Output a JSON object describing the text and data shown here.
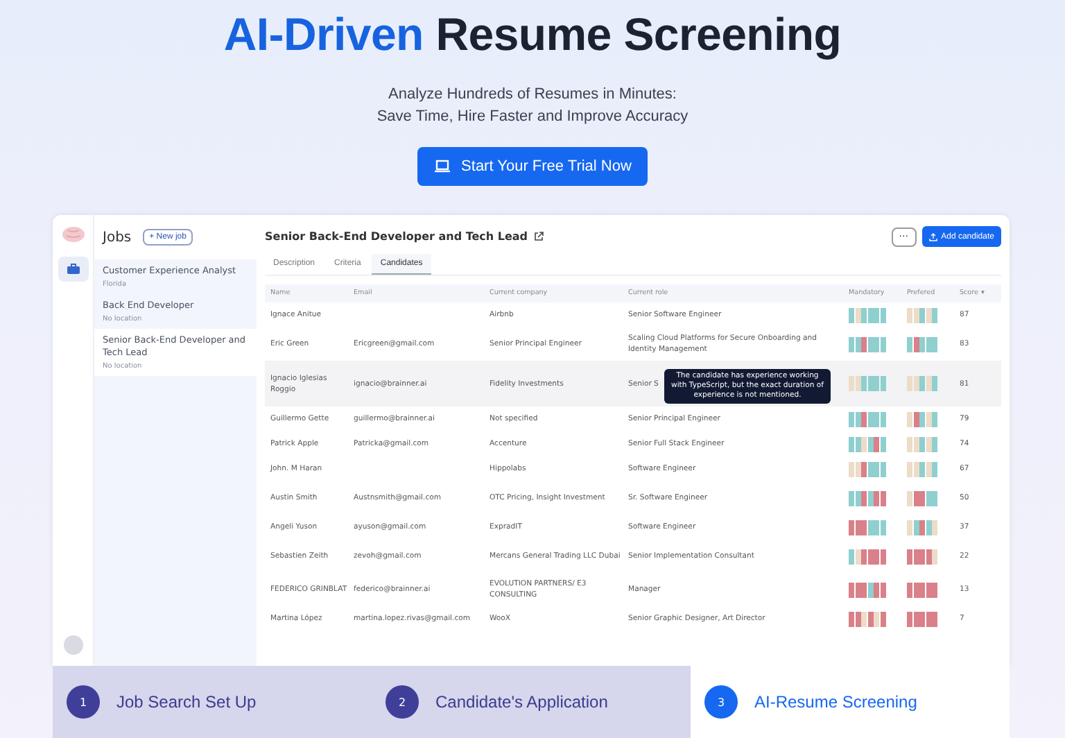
{
  "hero": {
    "title_highlight": "AI-Driven",
    "title_rest": "Resume Screening",
    "subtitle_lines": [
      "Analyze Hundreds of Resumes in Minutes:",
      "Save Time, Hire Faster and Improve Accuracy"
    ],
    "cta": "Start Your Free Trial Now"
  },
  "jobs_panel": {
    "title": "Jobs",
    "new_button": "+ New job",
    "items": [
      {
        "title": "Customer Experience Analyst",
        "location": "Florida",
        "selected": false
      },
      {
        "title": "Back End Developer",
        "location": "No location",
        "selected": false
      },
      {
        "title": "Senior Back-End Developer and Tech Lead",
        "location": "No location",
        "selected": true
      }
    ]
  },
  "job": {
    "title": "Senior Back-End Developer and Tech Lead",
    "more_button": "···",
    "add_button": "Add candidate",
    "tabs": [
      {
        "label": "Description",
        "selected": false
      },
      {
        "label": "Criteria",
        "selected": false
      },
      {
        "label": "Candidates",
        "selected": true
      }
    ]
  },
  "table": {
    "columns": [
      "Name",
      "Email",
      "Current company",
      "Current role",
      "Mandatory",
      "Prefered",
      "Score"
    ],
    "sort_mark": "▾",
    "rows": [
      {
        "name": "Ignace Anitue",
        "email": "",
        "company": "Airbnb",
        "role": "Senior Software Engineer",
        "mandatory": [
          {
            "color": "#8fcfcf"
          },
          {
            "color": "#ecdcc8"
          },
          {
            "color": "#8fcfcf"
          },
          {
            "color": "#8fcfcf"
          },
          {
            "color": "#8fcfcf"
          },
          {
            "color": "#8fcfcf"
          }
        ],
        "preferred": [
          {
            "color": "#ecdcc8"
          },
          {
            "color": "#ecdcc8"
          },
          {
            "color": "#8fcfcf"
          },
          {
            "color": "#ecdcc8"
          },
          {
            "color": "#8fcfcf"
          }
        ],
        "score": "87",
        "highlighted": false
      },
      {
        "name": "Eric Green",
        "email": "Ericgreen@gmail.com",
        "company": "Senior Principal Engineer",
        "role": "Scaling Cloud Platforms for Secure Onboarding and Identity Management",
        "mandatory": [
          {
            "color": "#8fcfcf"
          },
          {
            "color": "#8fcfcf"
          },
          {
            "color": "#d98089"
          },
          {
            "color": "#8fcfcf"
          },
          {
            "color": "#8fcfcf"
          },
          {
            "color": "#8fcfcf"
          }
        ],
        "preferred": [
          {
            "color": "#8fcfcf"
          },
          {
            "color": "#d98089"
          },
          {
            "color": "#8fcfcf"
          },
          {
            "color": "#8fcfcf"
          },
          {
            "color": "#8fcfcf"
          }
        ],
        "score": "83",
        "highlighted": false
      },
      {
        "name": "Ignacio Iglesias Roggio",
        "email": "ignacio@brainner.ai",
        "company": "Fidelity Investments",
        "role": "Senior S",
        "mandatory": [
          {
            "color": "#ecdcc8"
          },
          {
            "color": "#ecdcc8"
          },
          {
            "color": "#8fcfcf"
          },
          {
            "color": "#8fcfcf"
          },
          {
            "color": "#8fcfcf"
          },
          {
            "color": "#8fcfcf"
          }
        ],
        "preferred": [
          {
            "color": "#ecdcc8"
          },
          {
            "color": "#ecdcc8"
          },
          {
            "color": "#8fcfcf"
          },
          {
            "color": "#ecdcc8"
          },
          {
            "color": "#8fcfcf"
          }
        ],
        "score": "81",
        "highlighted": true
      },
      {
        "name": "Guillermo Gette",
        "email": "guillermo@brainner.ai",
        "company": "Not specified",
        "role": "Senior Principal Engineer",
        "mandatory": [
          {
            "color": "#8fcfcf"
          },
          {
            "color": "#8fcfcf"
          },
          {
            "color": "#d98089"
          },
          {
            "color": "#8fcfcf"
          },
          {
            "color": "#8fcfcf"
          },
          {
            "color": "#8fcfcf"
          }
        ],
        "preferred": [
          {
            "color": "#ecdcc8"
          },
          {
            "color": "#d98089"
          },
          {
            "color": "#8fcfcf"
          },
          {
            "color": "#ecdcc8"
          },
          {
            "color": "#8fcfcf"
          }
        ],
        "score": "79",
        "highlighted": false
      },
      {
        "name": "Patrick Apple",
        "email": "Patricka@gmail.com",
        "company": "Accenture",
        "role": "Senior Full Stack Engineer",
        "mandatory": [
          {
            "color": "#8fcfcf"
          },
          {
            "color": "#8fcfcf"
          },
          {
            "color": "#ecdcc8"
          },
          {
            "color": "#8fcfcf"
          },
          {
            "color": "#d98089"
          },
          {
            "color": "#8fcfcf"
          }
        ],
        "preferred": [
          {
            "color": "#ecdcc8"
          },
          {
            "color": "#ecdcc8"
          },
          {
            "color": "#8fcfcf"
          },
          {
            "color": "#ecdcc8"
          },
          {
            "color": "#8fcfcf"
          }
        ],
        "score": "74",
        "highlighted": false
      },
      {
        "name": "John. M Haran",
        "email": "",
        "company": "Hippolabs",
        "role": "Software Engineer",
        "mandatory": [
          {
            "color": "#ecdcc8"
          },
          {
            "color": "#ecdcc8"
          },
          {
            "color": "#d98089"
          },
          {
            "color": "#8fcfcf"
          },
          {
            "color": "#8fcfcf"
          },
          {
            "color": "#8fcfcf"
          }
        ],
        "preferred": [
          {
            "color": "#ecdcc8"
          },
          {
            "color": "#ecdcc8"
          },
          {
            "color": "#8fcfcf"
          },
          {
            "color": "#ecdcc8"
          },
          {
            "color": "#8fcfcf"
          }
        ],
        "score": "67",
        "highlighted": false
      },
      {
        "name": "Austin Smith",
        "email": "Austnsmith@gmail.com",
        "company": "OTC Pricing, Insight Investment",
        "role": "Sr. Software Engineer",
        "mandatory": [
          {
            "color": "#8fcfcf"
          },
          {
            "color": "#8fcfcf"
          },
          {
            "color": "#d98089"
          },
          {
            "color": "#8fcfcf"
          },
          {
            "color": "#d98089"
          },
          {
            "color": "#d98089"
          }
        ],
        "preferred": [
          {
            "color": "#ecdcc8"
          },
          {
            "color": "#d98089"
          },
          {
            "color": "#d98089"
          },
          {
            "color": "#8fcfcf"
          },
          {
            "color": "#8fcfcf"
          }
        ],
        "score": "50",
        "highlighted": false
      },
      {
        "name": "Angeli Yuson",
        "email": "ayuson@gmail.com",
        "company": "ExpradIT",
        "role": "Software Engineer",
        "mandatory": [
          {
            "color": "#d98089"
          },
          {
            "color": "#d98089"
          },
          {
            "color": "#d98089"
          },
          {
            "color": "#8fcfcf"
          },
          {
            "color": "#8fcfcf"
          },
          {
            "color": "#8fcfcf"
          }
        ],
        "preferred": [
          {
            "color": "#ecdcc8"
          },
          {
            "color": "#8fcfcf"
          },
          {
            "color": "#d98089"
          },
          {
            "color": "#8fcfcf"
          },
          {
            "color": "#ecdcc8"
          }
        ],
        "score": "37",
        "highlighted": false
      },
      {
        "name": "Sebastien Zeith",
        "email": "zevoh@gmail.com",
        "company": "Mercans General Trading LLC Dubai",
        "role": "Senior Implementation Consultant",
        "mandatory": [
          {
            "color": "#8fcfcf"
          },
          {
            "color": "#ecdcc8"
          },
          {
            "color": "#d98089"
          },
          {
            "color": "#d98089"
          },
          {
            "color": "#d98089"
          },
          {
            "color": "#d98089"
          }
        ],
        "preferred": [
          {
            "color": "#d98089"
          },
          {
            "color": "#d98089"
          },
          {
            "color": "#d98089"
          },
          {
            "color": "#d98089"
          },
          {
            "color": "#ecdcc8"
          }
        ],
        "score": "22",
        "highlighted": false
      },
      {
        "name": "FEDERICO GRINBLAT",
        "email": "federico@brainner.ai",
        "company": "EVOLUTION PARTNERS/ E3 CONSULTING",
        "role": "Manager",
        "mandatory": [
          {
            "color": "#d98089"
          },
          {
            "color": "#d98089"
          },
          {
            "color": "#d98089"
          },
          {
            "color": "#8fcfcf"
          },
          {
            "color": "#d98089"
          },
          {
            "color": "#d98089"
          }
        ],
        "preferred": [
          {
            "color": "#d98089"
          },
          {
            "color": "#d98089"
          },
          {
            "color": "#d98089"
          },
          {
            "color": "#d98089"
          },
          {
            "color": "#d98089"
          }
        ],
        "score": "13",
        "highlighted": false
      },
      {
        "name": "Martina López",
        "email": "martina.lopez.rivas@gmail.com",
        "company": "WooX",
        "role": "Senior Graphic Designer, Art Director",
        "mandatory": [
          {
            "color": "#d98089"
          },
          {
            "color": "#d98089"
          },
          {
            "color": "#ecdcc8"
          },
          {
            "color": "#d98089"
          },
          {
            "color": "#ecdcc8"
          },
          {
            "color": "#d98089"
          }
        ],
        "preferred": [
          {
            "color": "#d98089"
          },
          {
            "color": "#d98089"
          },
          {
            "color": "#d98089"
          },
          {
            "color": "#d98089"
          },
          {
            "color": "#d98089"
          }
        ],
        "score": "7",
        "highlighted": false
      }
    ]
  },
  "tooltip": "The candidate has experience working with TypeScript, but the exact duration of experience is not mentioned.",
  "steps": [
    {
      "number": "1",
      "label": "Job Search Set Up",
      "selected": false
    },
    {
      "number": "2",
      "label": "Candidate's Application",
      "selected": false
    },
    {
      "number": "3",
      "label": "AI-Resume Screening",
      "selected": true
    }
  ]
}
